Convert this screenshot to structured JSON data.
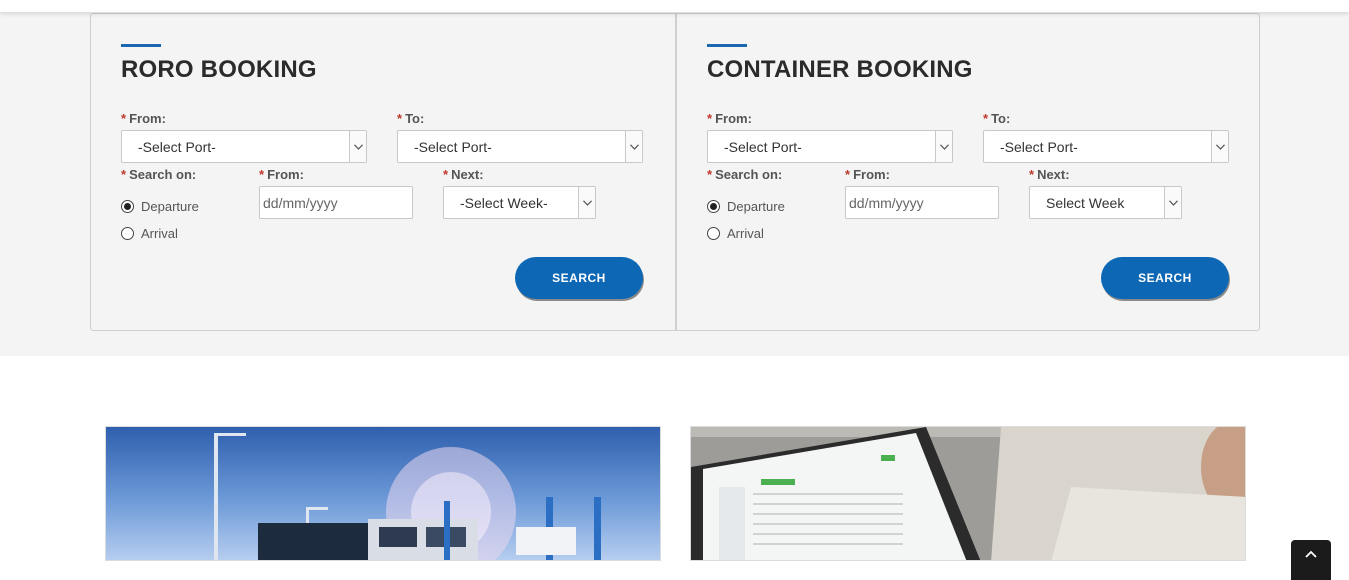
{
  "roro": {
    "title": "RORO BOOKING",
    "from_label": "From:",
    "from_value": "-Select Port-",
    "to_label": "To:",
    "to_value": "-Select Port-",
    "search_on_label": "Search on:",
    "departure_label": "Departure",
    "arrival_label": "Arrival",
    "date_from_label": "From:",
    "date_placeholder": "dd/mm/yyyy",
    "next_label": "Next:",
    "next_value": "-Select Week-",
    "search_button": "SEARCH"
  },
  "container": {
    "title": "CONTAINER BOOKING",
    "from_label": "From:",
    "from_value": "-Select Port-",
    "to_label": "To:",
    "to_value": "-Select Port-",
    "search_on_label": "Search on:",
    "departure_label": "Departure",
    "arrival_label": "Arrival",
    "date_from_label": "From:",
    "date_placeholder": "dd/mm/yyyy",
    "next_label": "Next:",
    "next_value": "Select Week",
    "search_button": "SEARCH"
  },
  "required_marker": "*",
  "icons": {
    "select_arrow": "chevron-down-icon",
    "back_to_top": "chevron-up-icon"
  },
  "colors": {
    "accent": "#1a66b0",
    "button": "#0d67b5",
    "required": "#c0392b"
  }
}
